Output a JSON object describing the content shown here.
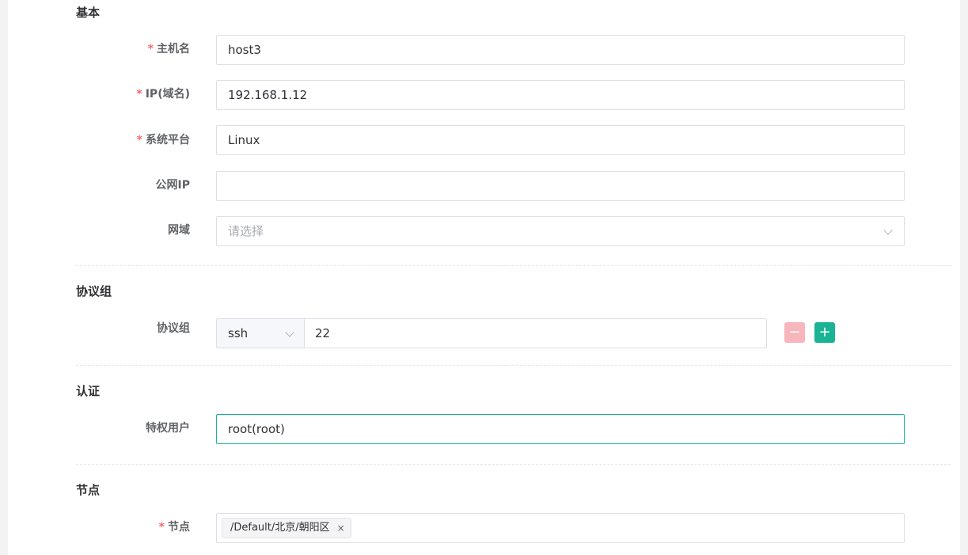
{
  "sections": {
    "basic": "基本",
    "protocols": "协议组",
    "auth": "认证",
    "nodes": "节点"
  },
  "required_mark": "*",
  "fields": {
    "hostname": {
      "label": "主机名",
      "value": "host3"
    },
    "ip": {
      "label": "IP(域名)",
      "value": "192.168.1.12"
    },
    "platform": {
      "label": "系统平台",
      "value": "Linux"
    },
    "public_ip": {
      "label": "公网IP",
      "value": ""
    },
    "domain": {
      "label": "网域",
      "placeholder": "请选择"
    },
    "protocol": {
      "label": "协议组",
      "type": "ssh",
      "port": "22",
      "remove_symbol": "−",
      "add_symbol": "+"
    },
    "admin_user": {
      "label": "特权用户",
      "value": "root(root)"
    },
    "node": {
      "label": "节点",
      "tag": "/Default/北京/朝阳区",
      "tag_close": "×"
    }
  },
  "colors": {
    "accent": "#1ab394",
    "required": "#f56c6c",
    "remove_button": "#f7b6bc"
  }
}
